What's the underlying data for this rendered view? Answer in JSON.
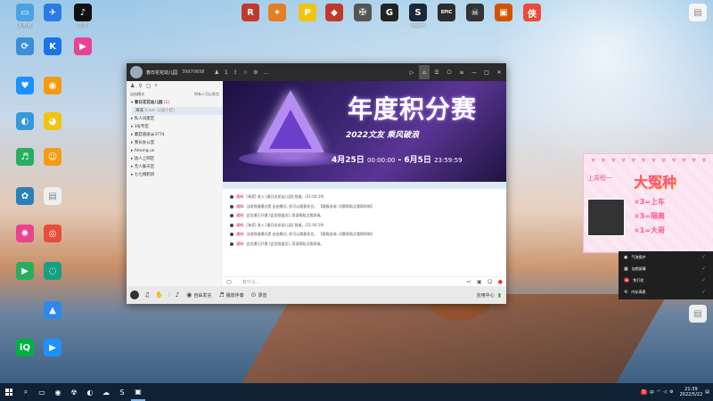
{
  "desktop": {
    "icons": [
      {
        "label": "此电脑",
        "color": "#4aa3df",
        "glyph": "▭"
      },
      {
        "label": "",
        "color": "#2c7be5",
        "glyph": "✈"
      },
      {
        "label": "抖音",
        "color": "#111111",
        "glyph": "♪"
      },
      {
        "label": "",
        "color": "#c0392b",
        "glyph": "R"
      },
      {
        "label": "",
        "color": "#e67e22",
        "glyph": "✦"
      },
      {
        "label": "",
        "color": "#f1c40f",
        "glyph": "P"
      },
      {
        "label": "",
        "color": "#c0392b",
        "glyph": "◆"
      },
      {
        "label": "",
        "color": "#555555",
        "glyph": "✠"
      },
      {
        "label": "",
        "color": "#222222",
        "glyph": "G"
      },
      {
        "label": "steam",
        "color": "#1b2838",
        "glyph": "S"
      },
      {
        "label": "",
        "color": "#2c2c2c",
        "glyph": "EPIC"
      },
      {
        "label": "",
        "color": "#333333",
        "glyph": "☠"
      },
      {
        "label": "",
        "color": "#d35400",
        "glyph": "▣"
      },
      {
        "label": "",
        "color": "#e74c3c",
        "glyph": "侠"
      },
      {
        "label": "",
        "color": "#3b8ed8",
        "glyph": "⟳"
      },
      {
        "label": "",
        "color": "#1a73e8",
        "glyph": "K"
      },
      {
        "label": "",
        "color": "#e84393",
        "glyph": "▶"
      },
      {
        "label": "",
        "color": "#1e90ff",
        "glyph": "♥"
      },
      {
        "label": "",
        "color": "#f39c12",
        "glyph": "◉"
      },
      {
        "label": "",
        "color": "#3498db",
        "glyph": "◐"
      },
      {
        "label": "",
        "color": "#f1c40f",
        "glyph": "◕"
      },
      {
        "label": "",
        "color": "#27ae60",
        "glyph": "♬"
      },
      {
        "label": "",
        "color": "#f39c12",
        "glyph": "☺"
      },
      {
        "label": "",
        "color": "#2980b9",
        "glyph": "✿"
      },
      {
        "label": "",
        "color": "#ecf0f1",
        "glyph": "▤"
      },
      {
        "label": "",
        "color": "#e84393",
        "glyph": "✺"
      },
      {
        "label": "",
        "color": "#e74c3c",
        "glyph": "◎"
      },
      {
        "label": "",
        "color": "#27ae60",
        "glyph": "▶"
      },
      {
        "label": "",
        "color": "#16a085",
        "glyph": "◌"
      },
      {
        "label": "",
        "color": "#2d89ef",
        "glyph": "▲"
      },
      {
        "label": "",
        "color": "#00b140",
        "glyph": "iQ"
      },
      {
        "label": "",
        "color": "#1e90ff",
        "glyph": "▶"
      },
      {
        "label": "",
        "color": "#f5f5f5",
        "glyph": "▤"
      },
      {
        "label": "",
        "color": "#eeeeee",
        "glyph": "▤"
      }
    ]
  },
  "window": {
    "room_name": "春日花花幼儿园",
    "room_id": "39970698",
    "user_count": "1",
    "left_panel": {
      "header_left": "自由模式",
      "header_right": "所有人可以发言",
      "channels": [
        {
          "name": "春日花花幼儿园",
          "suffix": "(1)",
          "type": "main"
        },
        {
          "name": "海滨",
          "suffix": "[Live: 公园小区]",
          "type": "user"
        },
        {
          "name": "私人试麦区",
          "suffix": "",
          "type": "channel"
        },
        {
          "name": "3号专区",
          "suffix": "",
          "type": "channel"
        },
        {
          "name": "蘑菇悬崖@3774",
          "suffix": "",
          "type": "channel"
        },
        {
          "name": "我长办公室",
          "suffix": "",
          "type": "channel"
        },
        {
          "name": "Among us",
          "suffix": "",
          "type": "channel"
        },
        {
          "name": "放人上网区",
          "suffix": "",
          "type": "channel"
        },
        {
          "name": "无人躲天区",
          "suffix": "",
          "type": "channel"
        },
        {
          "name": "七七搏鹤鸽",
          "suffix": "",
          "type": "channel"
        }
      ]
    },
    "banner": {
      "title": "年度积分赛",
      "subtitle": "2022文友 乘风破浪",
      "date_start": "4月25日",
      "time_start": "00:00:00",
      "date_end": "6月5日",
      "time_end": "23:59:59"
    },
    "messages": [
      {
        "tag": "通知:",
        "text": "[海滨] 进入 [春日花花幼儿园] 频道。(21:00:19)"
      },
      {
        "tag": "通知:",
        "text": "当前频道模式是 自由模式, 你可以随意发言。 【客服咨询, 问题帮助点我帮你哟】"
      },
      {
        "tag": "通知:",
        "text": "会员通已开通 [会员频道员], 用语帮助点我如瑞。"
      },
      {
        "tag": "通知:",
        "text": "[海滨] 进入 [春日花花幼儿园] 频道。(21:00:19)"
      },
      {
        "tag": "通知:",
        "text": "当前频道模式是 自由模式, 你可以随意发言。 【客服咨询, 问题帮助点我帮你哟】"
      },
      {
        "tag": "通知:",
        "text": "会员通已开通 [会员频道员], 用语帮助点我如瑞。"
      }
    ],
    "input_placeholder": "有什么...",
    "bottom_bar": {
      "items": [
        "自由发言",
        "播放伴奏",
        "录音"
      ],
      "right_label": "应用中心"
    }
  },
  "ad_popup": {
    "hearts": "♥ ♥ ♥ ♥ ♥ ♥ ♥ ♥ ♥ ♥ ♥ ♥",
    "left_text": "上周榜一",
    "title": "大冤种",
    "lines": [
      "×3=上车",
      "×3=隔离",
      "×1=大哥"
    ]
  },
  "tray_popup": {
    "items": [
      {
        "label": "气泡保护",
        "glyph": "◉"
      },
      {
        "label": "加锁屏幕",
        "glyph": "▦"
      },
      {
        "label": "免打扰",
        "glyph": "⛔"
      },
      {
        "label": "内存清理",
        "glyph": "⟲"
      }
    ]
  },
  "taskbar": {
    "apps": [
      "⌕",
      "▭",
      "◉",
      "☢",
      "◐",
      "☁",
      "S",
      "▣"
    ],
    "tray_text": "中",
    "time": "21:39",
    "date": "2022/5/22"
  }
}
